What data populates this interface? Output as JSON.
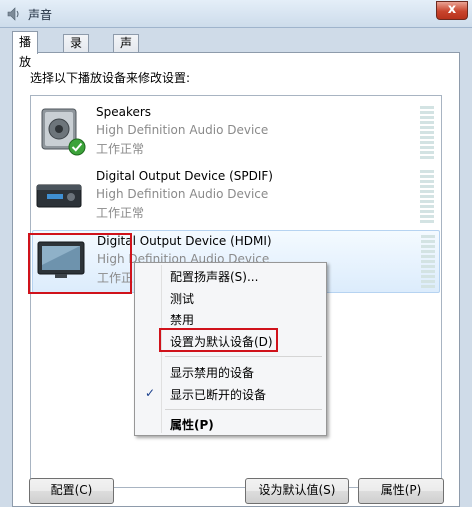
{
  "window": {
    "title": "声音",
    "close_label": "x"
  },
  "tabs": [
    {
      "label": "播放",
      "active": true
    },
    {
      "label": "录制",
      "active": false
    },
    {
      "label": "声音",
      "active": false
    }
  ],
  "instruction": "选择以下播放设备来修改设置:",
  "devices": [
    {
      "name": "Speakers",
      "description": "High Definition Audio Device",
      "status": "工作正常",
      "icon": "speaker-icon",
      "default_check": true
    },
    {
      "name": "Digital Output Device (SPDIF)",
      "description": "High Definition Audio Device",
      "status": "工作正常",
      "icon": "receiver-icon"
    },
    {
      "name": "Digital Output Device (HDMI)",
      "description": "High Definition Audio Device",
      "status": "工作正常",
      "icon": "monitor-icon",
      "selected": true
    }
  ],
  "context_menu": {
    "items": [
      {
        "label": "配置扬声器(S)..."
      },
      {
        "label": "测试"
      },
      {
        "label": "禁用"
      },
      {
        "label": "设置为默认设备(D)",
        "highlighted": true
      },
      {
        "label": "显示禁用的设备"
      },
      {
        "label": "显示已断开的设备",
        "checked": true
      },
      {
        "label": "属性(P)",
        "bold": true
      }
    ],
    "check_glyph": "✓"
  },
  "buttons": {
    "configure": "配置(C)",
    "set_default": "设为默认值(S)",
    "properties": "属性(P)"
  },
  "colors": {
    "highlight_red": "#d0121b",
    "selection_blue": "#dcecfc"
  }
}
